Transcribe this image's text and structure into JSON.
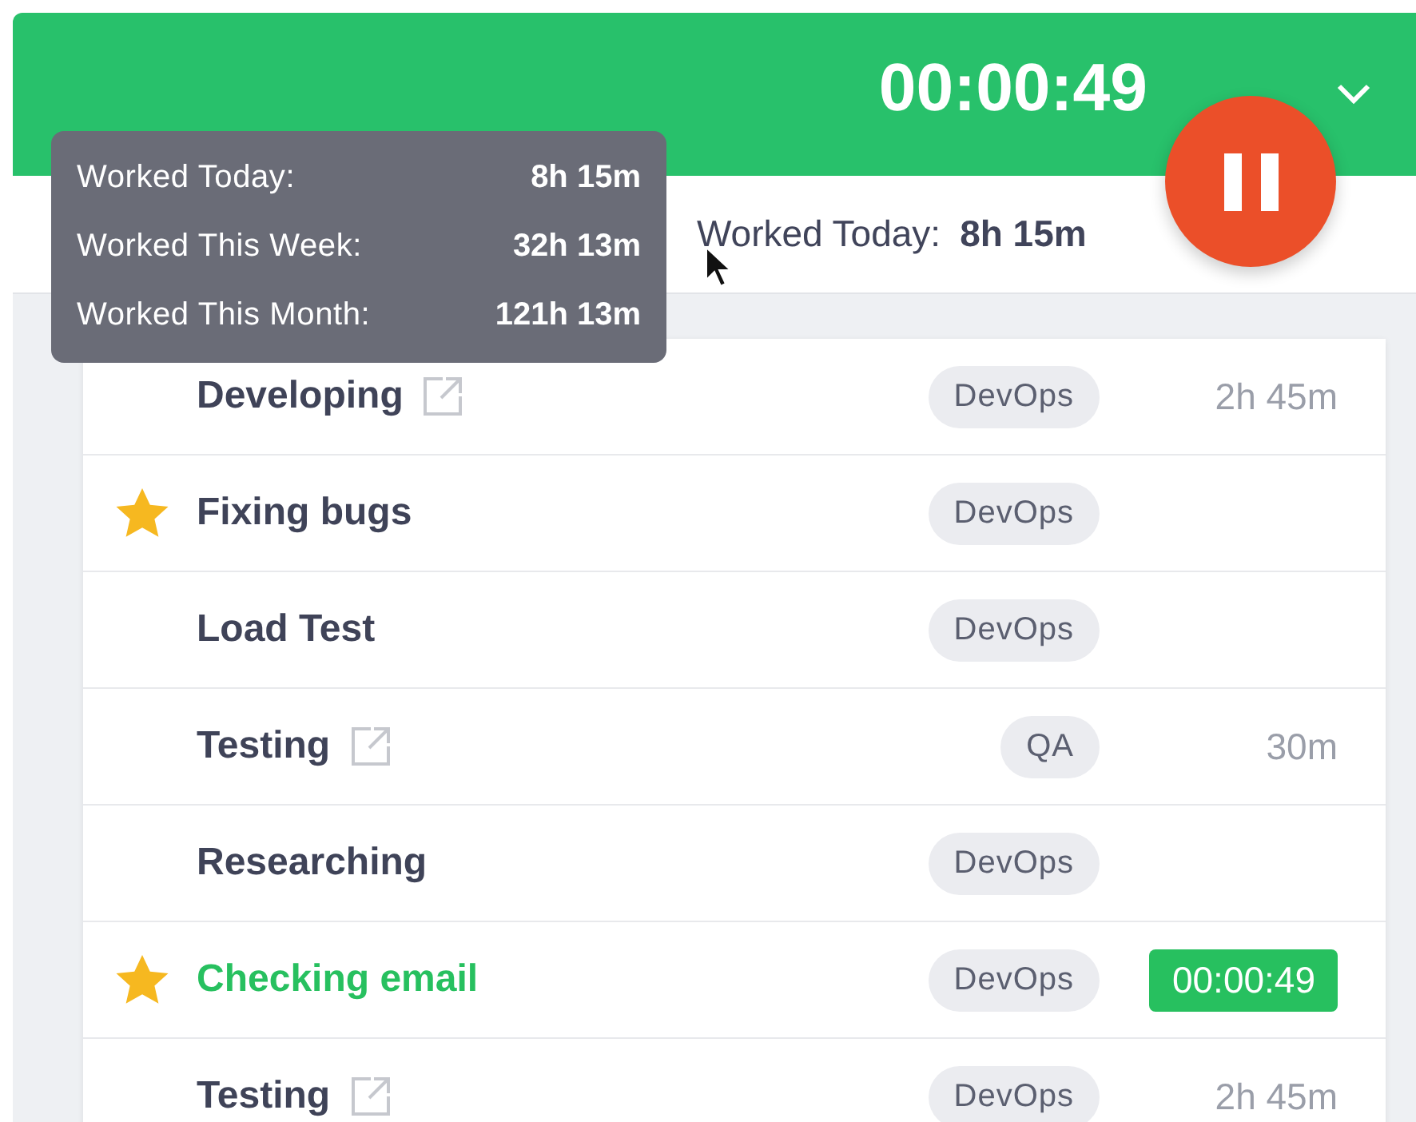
{
  "header": {
    "timer": "00:00:49"
  },
  "tooltip": {
    "rows": [
      {
        "label": "Worked Today:",
        "value": "8h 15m"
      },
      {
        "label": "Worked This Week:",
        "value": "32h 13m"
      },
      {
        "label": "Worked This Month:",
        "value": "121h 13m"
      }
    ]
  },
  "summary": {
    "label": "Worked Today:",
    "value": "8h 15m"
  },
  "tasks": [
    {
      "name": "Developing",
      "starred": false,
      "link": true,
      "tag": "DevOps",
      "time": "2h 45m",
      "running": false
    },
    {
      "name": "Fixing bugs",
      "starred": true,
      "link": false,
      "tag": "DevOps",
      "running": false
    },
    {
      "name": "Load Test",
      "starred": false,
      "link": false,
      "tag": "DevOps",
      "running": false
    },
    {
      "name": "Testing",
      "starred": false,
      "link": true,
      "tag": "QA",
      "time": "30m",
      "running": false
    },
    {
      "name": "Researching",
      "starred": false,
      "link": false,
      "tag": "DevOps",
      "running": false
    },
    {
      "name": "Checking email",
      "starred": true,
      "link": false,
      "tag": "DevOps",
      "time": "00:00:49",
      "running": true
    },
    {
      "name": "Testing",
      "starred": false,
      "link": true,
      "tag": "DevOps",
      "time": "2h 45m",
      "running": false
    }
  ]
}
